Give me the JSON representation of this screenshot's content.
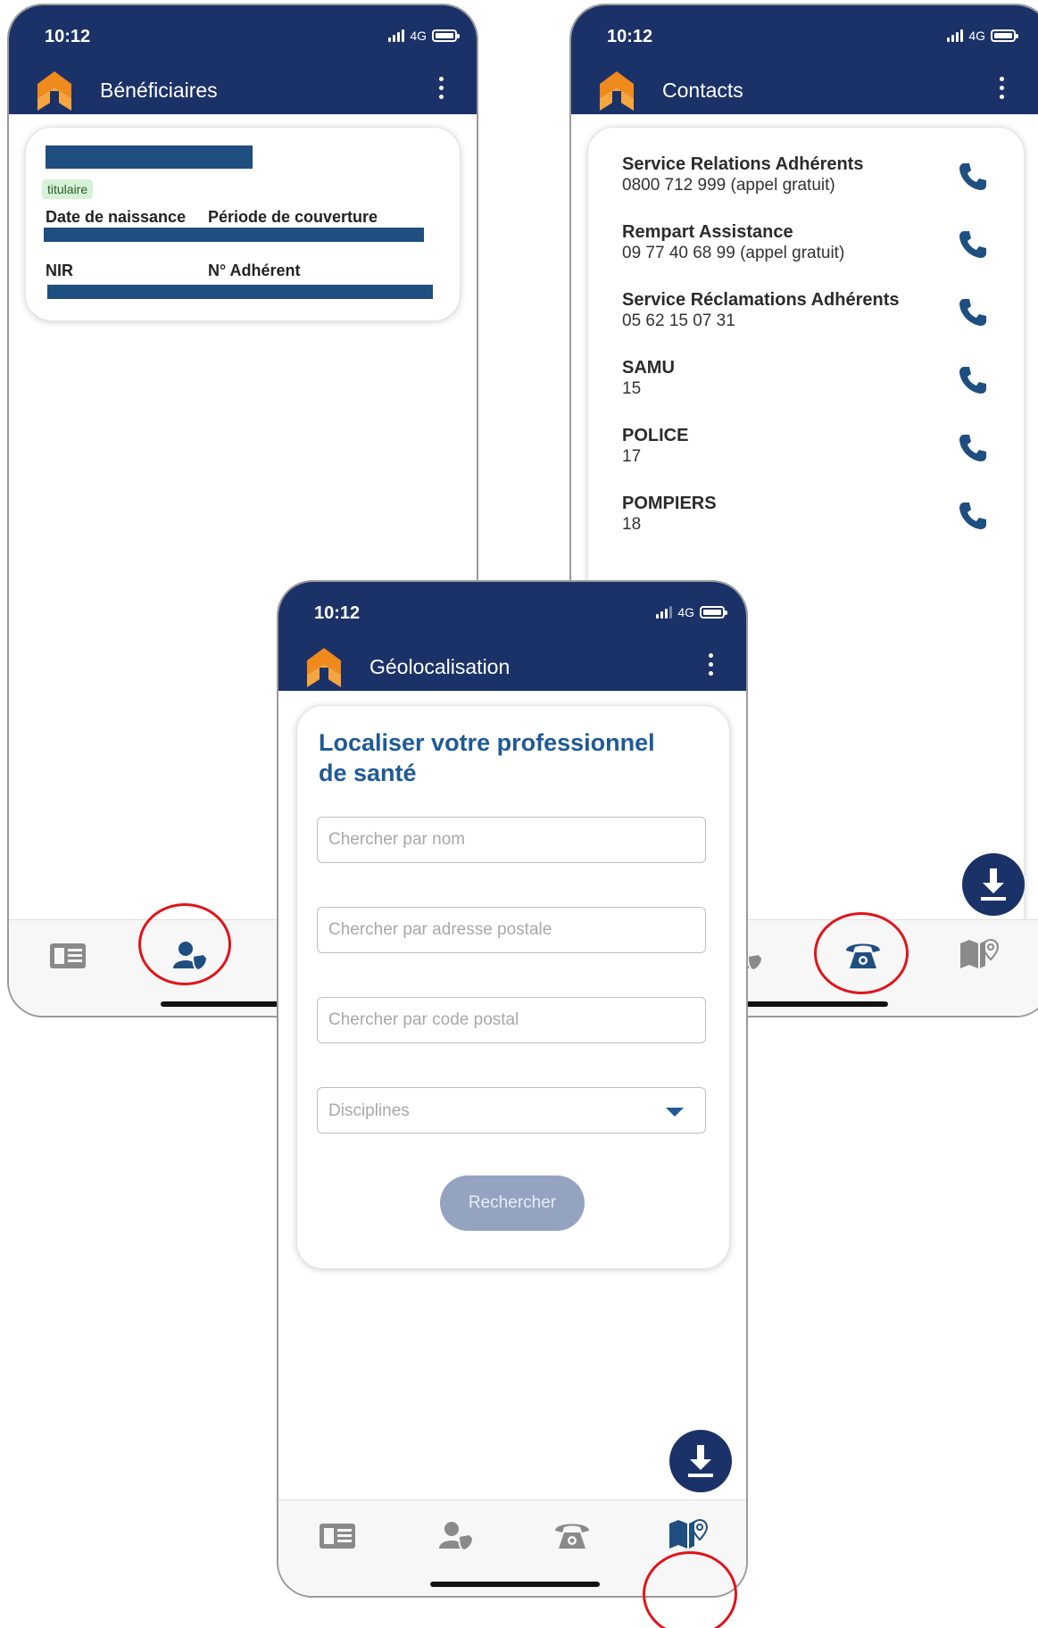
{
  "colors": {
    "primary": "#1b3268",
    "accent": "#1f5a96",
    "logo_orange": "#f08a1c",
    "annotation_red": "#e0141a",
    "button_disabled": "#93a3c0",
    "tag_green_bg": "#d6f2d6"
  },
  "status": {
    "time": "10:12",
    "network": "4G"
  },
  "beneficiaires": {
    "title": "Bénéficiaires",
    "tag": "titulaire",
    "label_birth": "Date de naissance",
    "label_coverage": "Période de couverture",
    "label_nir": "NIR",
    "label_member": "N° Adhérent"
  },
  "contacts": {
    "title": "Contacts",
    "items": [
      {
        "name": "Service Relations Adhérents",
        "number": "0800 712 999 (appel gratuit)"
      },
      {
        "name": "Rempart Assistance",
        "number": "09 77 40 68 99 (appel gratuit)"
      },
      {
        "name": "Service Réclamations Adhérents",
        "number": "05 62 15 07 31"
      },
      {
        "name": "SAMU",
        "number": "15"
      },
      {
        "name": "POLICE",
        "number": "17"
      },
      {
        "name": "POMPIERS",
        "number": "18"
      }
    ]
  },
  "geolocalisation": {
    "title": "Géolocalisation",
    "heading": "Localiser votre professionnel de santé",
    "placeholder_name": "Chercher par nom",
    "placeholder_address": "Chercher par adresse postale",
    "placeholder_postal": "Chercher par code postal",
    "select_disciplines": "Disciplines",
    "search_button": "Rechercher"
  },
  "icons": {
    "menu": "kebab-menu-icon",
    "phone": "phone-icon",
    "download": "download-icon",
    "tab_card": "id-card-icon",
    "tab_beneficiaries": "beneficiaries-icon",
    "tab_contacts": "telephone-icon",
    "tab_geo": "map-pin-icon"
  }
}
